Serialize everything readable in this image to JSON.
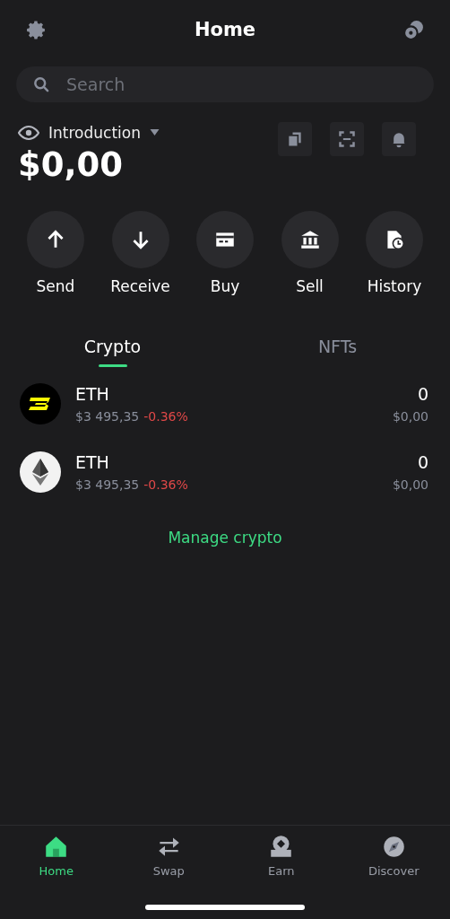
{
  "header": {
    "title": "Home"
  },
  "search": {
    "placeholder": "Search"
  },
  "balance": {
    "label": "Introduction",
    "amount": "$0,00"
  },
  "actions": [
    {
      "kind": "send",
      "label": "Send"
    },
    {
      "kind": "receive",
      "label": "Receive"
    },
    {
      "kind": "buy",
      "label": "Buy"
    },
    {
      "kind": "sell",
      "label": "Sell"
    },
    {
      "kind": "history",
      "label": "History"
    }
  ],
  "tabs": [
    {
      "label": "Crypto",
      "selected": true
    },
    {
      "label": "NFTs",
      "selected": false
    }
  ],
  "assets": [
    {
      "kind": "blast",
      "symbol": "ETH",
      "price": "$3 495,35",
      "change": "-0.36%",
      "amount": "0",
      "value": "$0,00"
    },
    {
      "kind": "eth",
      "symbol": "ETH",
      "price": "$3 495,35",
      "change": "-0.36%",
      "amount": "0",
      "value": "$0,00"
    }
  ],
  "manage_link": "Manage crypto",
  "nav": [
    {
      "kind": "home",
      "label": "Home",
      "selected": true
    },
    {
      "kind": "swap",
      "label": "Swap",
      "selected": false
    },
    {
      "kind": "earn",
      "label": "Earn",
      "selected": false
    },
    {
      "kind": "discover",
      "label": "Discover",
      "selected": false
    }
  ]
}
